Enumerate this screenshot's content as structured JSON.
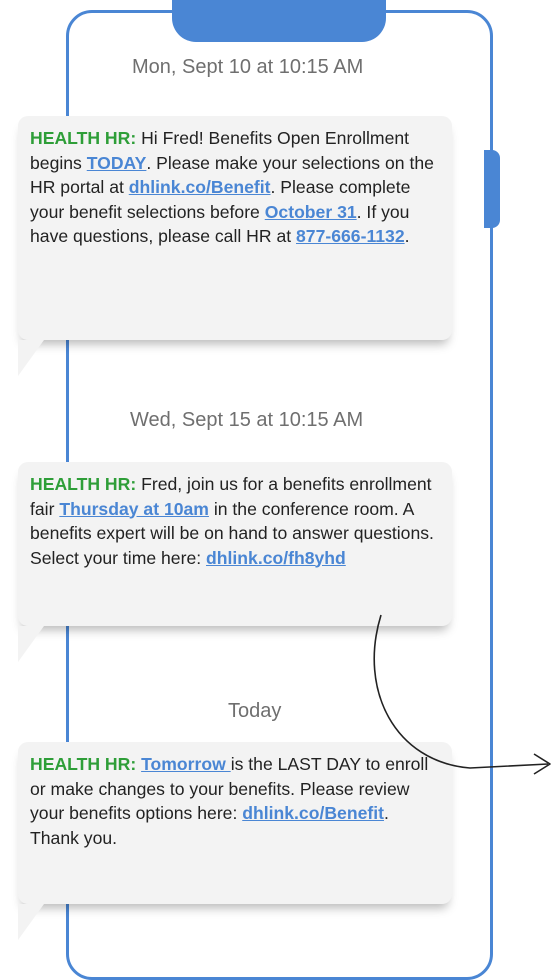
{
  "conversation": {
    "sender": "HEALTH HR:",
    "messages": [
      {
        "timestamp": "Mon, Sept 10 at 10:15 AM",
        "t1": " Hi Fred! Benefits Open Enrollment begins ",
        "l1": "TODAY",
        "t2": ". Please make your selections on the HR portal at ",
        "l2": "dhlink.co/Benefit",
        "t3": ". Please complete your benefit selections before ",
        "l3": "October 31",
        "t4": ". If you have questions, please call HR at ",
        "l4": "877-666-1132",
        "t5": "."
      },
      {
        "timestamp": "Wed, Sept 15 at 10:15 AM",
        "t1": " Fred, join us for a benefits enrollment fair ",
        "l1": "Thursday at 10am",
        "t2": " in the conference room. A benefits expert will be on hand to answer questions. Select your time here: ",
        "l2": "dhlink.co/fh8yhd"
      },
      {
        "timestamp": "Today",
        "l1": "Tomorrow ",
        "t1": "is the LAST DAY to enroll or make changes to your benefits. Please review your benefits options here: ",
        "l2": "dhlink.co/Benefit",
        "t2": ". Thank you."
      }
    ]
  },
  "colors": {
    "accent": "#4a86d4",
    "sender": "#2e9e38",
    "bubble": "#f3f3f3"
  }
}
